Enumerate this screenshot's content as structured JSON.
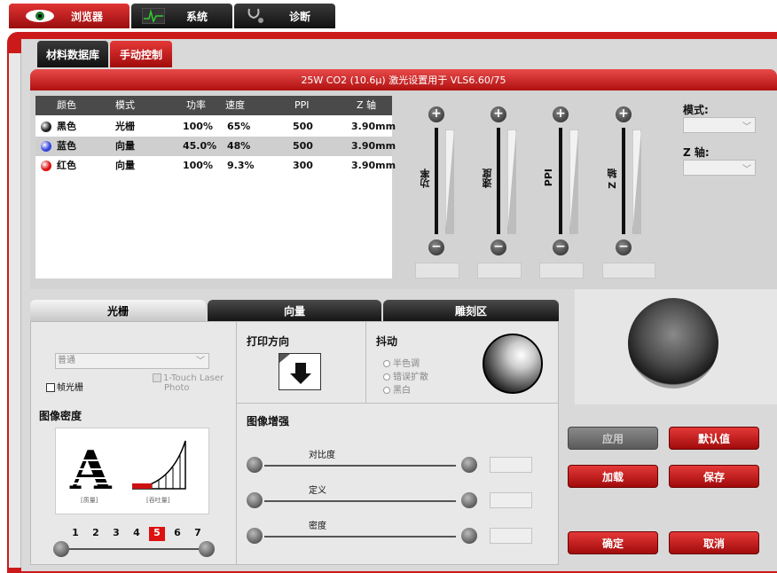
{
  "top_tabs": [
    {
      "label": "浏览器",
      "icon": "eye-icon"
    },
    {
      "label": "系统",
      "icon": "waveform-icon"
    },
    {
      "label": "诊断",
      "icon": "stethoscope-icon"
    }
  ],
  "sub_tabs": [
    "材料数据库",
    "手动控制"
  ],
  "title": "25W CO2 (10.6µ) 激光设置用于 VLS6.60/75",
  "table": {
    "headers": [
      "颜色",
      "模式",
      "功率",
      "速度",
      "PPI",
      "Z 轴"
    ],
    "rows": [
      {
        "color": "黑色",
        "mode": "光栅",
        "power": "100%",
        "speed": "65%",
        "ppi": "500",
        "z": "3.90mm",
        "dot": "#222222"
      },
      {
        "color": "蓝色",
        "mode": "向量",
        "power": "45.0%",
        "speed": "48%",
        "ppi": "500",
        "z": "3.90mm",
        "dot": "#3344dd"
      },
      {
        "color": "红色",
        "mode": "向量",
        "power": "100%",
        "speed": "9.3%",
        "ppi": "300",
        "z": "3.90mm",
        "dot": "#dd1111"
      }
    ]
  },
  "sliders": [
    "功率",
    "速度",
    "PPI",
    "Z 轴"
  ],
  "right_fields": {
    "mode_label": "模式:",
    "z_label": "Z 轴:"
  },
  "lower_tabs": [
    "光栅",
    "向量",
    "雕刻区"
  ],
  "raster": {
    "quality_select": "普通",
    "frame_raster": "帧光栅",
    "one_touch_line1": "1-Touch Laser",
    "one_touch_line2": "Photo",
    "image_density": "图像密度",
    "preview_quality": "[质量]",
    "preview_speed": "[吞吐量]",
    "density_levels": [
      "1",
      "2",
      "3",
      "4",
      "5",
      "6",
      "7"
    ],
    "density_selected": "5"
  },
  "print_direction": "打印方向",
  "dither": {
    "title": "抖动",
    "options": [
      "半色调",
      "错误扩散",
      "黑白"
    ]
  },
  "image_enhance": {
    "title": "图像增强",
    "items": [
      "对比度",
      "定义",
      "密度"
    ]
  },
  "buttons": {
    "apply": "应用",
    "default": "默认值",
    "load": "加载",
    "save": "保存",
    "ok": "确定",
    "cancel": "取消"
  }
}
